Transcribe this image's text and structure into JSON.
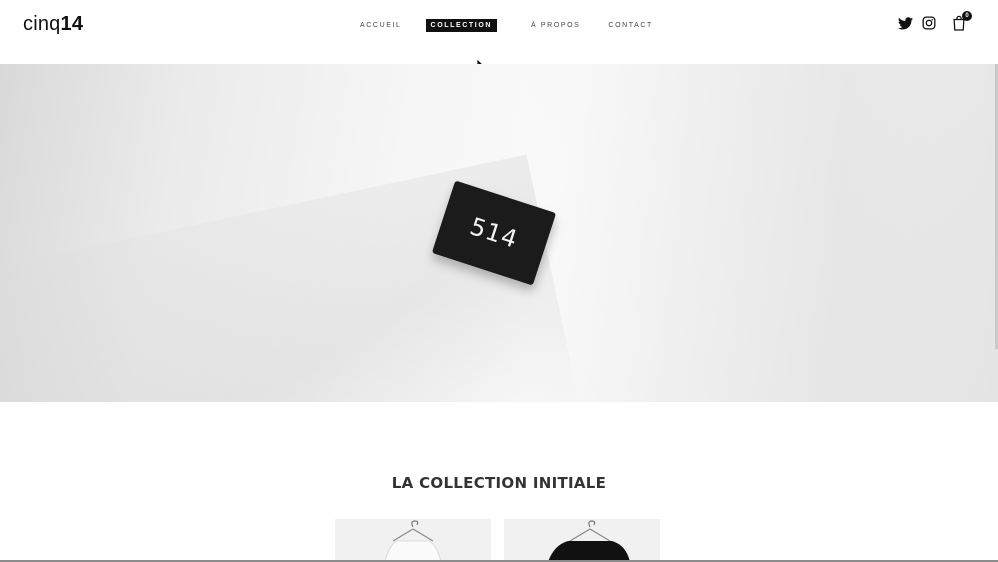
{
  "header": {
    "logo": {
      "light": "cinq",
      "bold": "14"
    },
    "nav": [
      {
        "label": "ACCUEIL",
        "active": false
      },
      {
        "label": "COLLECTION",
        "active": true
      },
      {
        "label": "À PROPOS",
        "active": false
      },
      {
        "label": "CONTACT",
        "active": false
      }
    ],
    "social": {
      "icons": [
        "twitter-icon",
        "instagram-icon",
        "cart-icon"
      ],
      "cart_count": "0"
    }
  },
  "hero": {
    "tag_text": "514"
  },
  "section": {
    "title": "LA COLLECTION INITIALE"
  },
  "colors": {
    "accent": "#111111",
    "background": "#ffffff"
  }
}
